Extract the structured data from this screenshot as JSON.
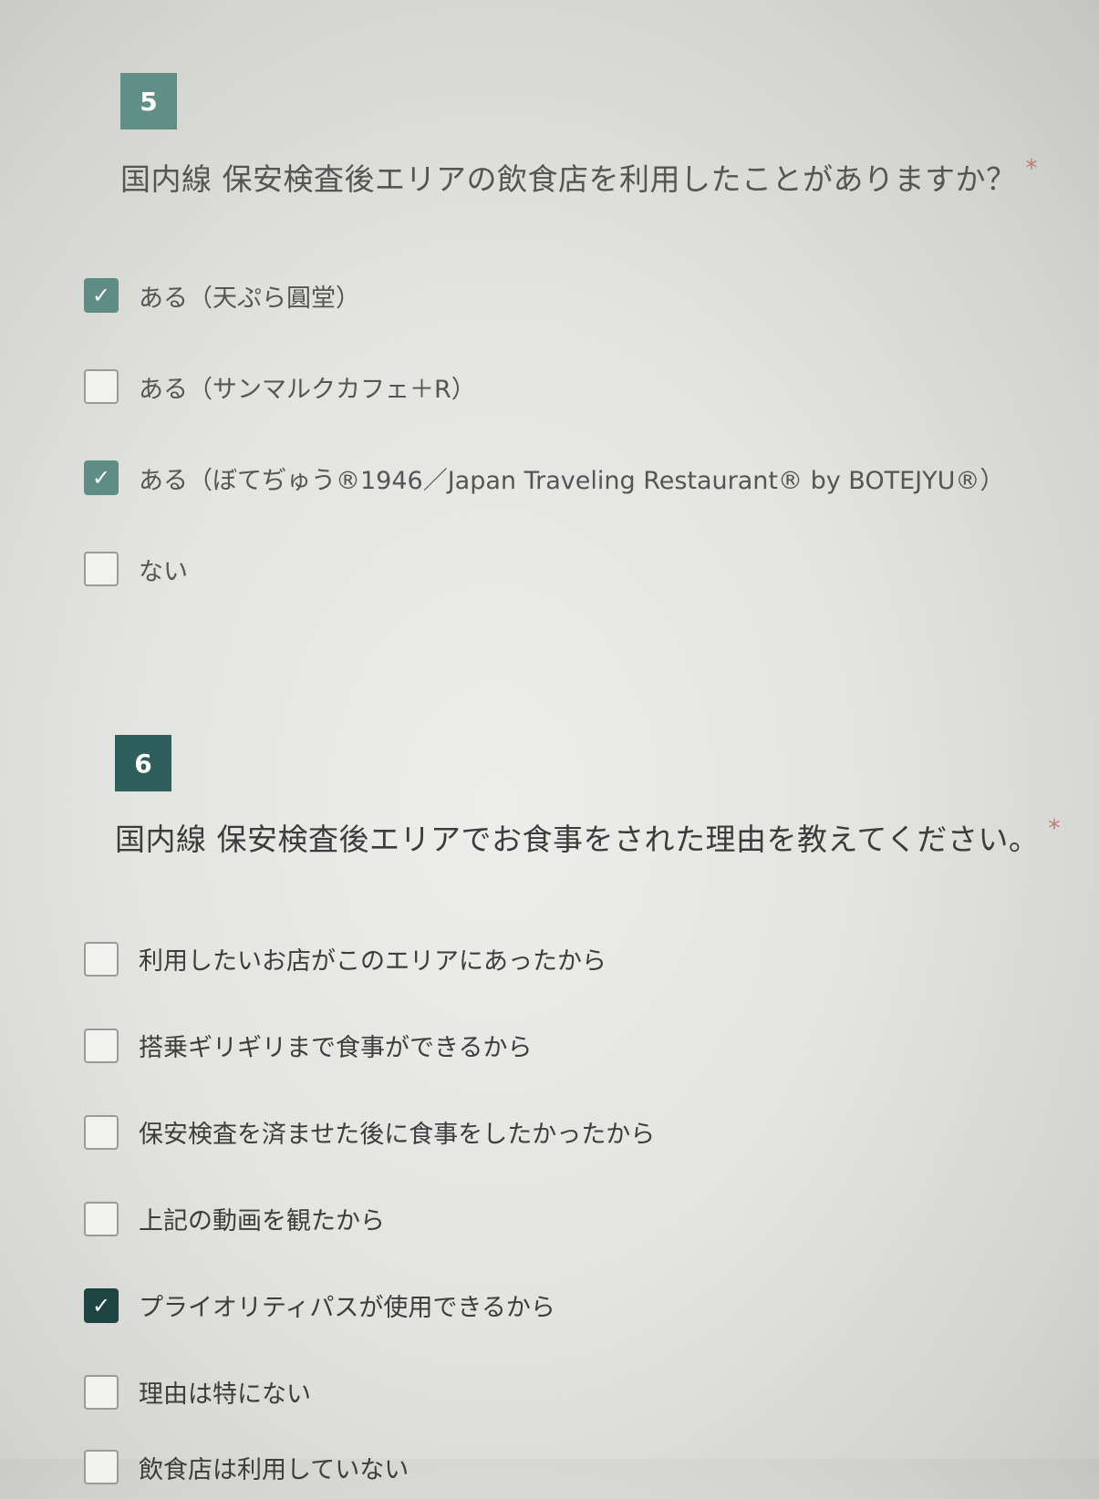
{
  "questions": [
    {
      "number": "5",
      "title": "国内線 保安検査後エリアの飲食店を利用したことがありますか？",
      "required_mark": "*",
      "options": [
        {
          "label": "ある（天ぷら圓堂）",
          "checked": true
        },
        {
          "label": "ある（サンマルクカフェ＋R）",
          "checked": false
        },
        {
          "label": "ある（ぼてぢゅう®1946／Japan Traveling Restaurant® by BOTEJYU®）",
          "checked": true
        },
        {
          "label": "ない",
          "checked": false
        }
      ]
    },
    {
      "number": "6",
      "title": "国内線 保安検査後エリアでお食事をされた理由を教えてください。",
      "required_mark": "*",
      "options": [
        {
          "label": "利用したいお店がこのエリアにあったから",
          "checked": false
        },
        {
          "label": "搭乗ギリギリまで食事ができるから",
          "checked": false
        },
        {
          "label": "保安検査を済ませた後に食事をしたかったから",
          "checked": false
        },
        {
          "label": "上記の動画を観たから",
          "checked": false
        },
        {
          "label": "プライオリティパスが使用できるから",
          "checked": true
        },
        {
          "label": "理由は特にない",
          "checked": false
        },
        {
          "label": "飲食店は利用していない",
          "checked": false
        }
      ]
    }
  ],
  "icons": {
    "checkmark": "check-icon"
  },
  "colors": {
    "q5_accent": "#5f8f86",
    "q6_accent": "#2f5f5c",
    "required": "#c0796f"
  }
}
